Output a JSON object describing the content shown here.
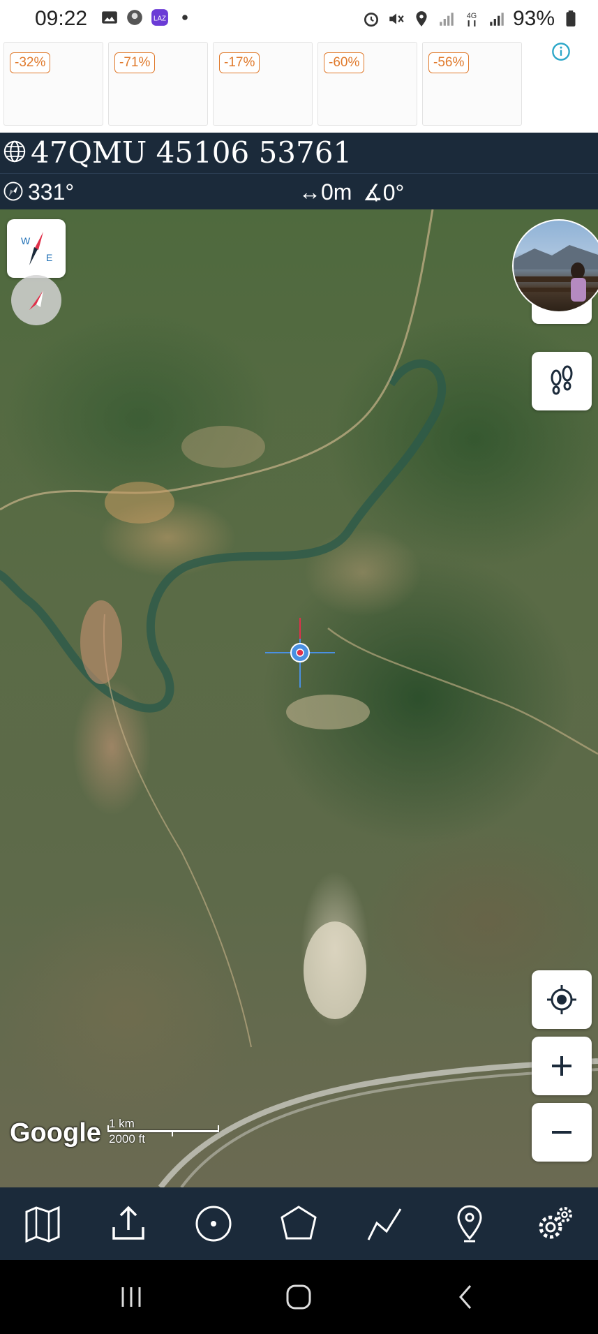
{
  "status_bar": {
    "time": "09:22",
    "battery": "93%",
    "left_icons": [
      "gallery-icon",
      "app-icon",
      "lazada-icon",
      "dot-icon"
    ],
    "right_icons": [
      "alarm-icon",
      "mute-icon",
      "location-icon",
      "signal-icon",
      "4g-icon",
      "signal-icon",
      "battery-icon"
    ]
  },
  "ads": {
    "items": [
      {
        "discount": "-32%"
      },
      {
        "discount": "-71%"
      },
      {
        "discount": "-17%"
      },
      {
        "discount": "-60%"
      },
      {
        "discount": "-56%"
      }
    ],
    "info_icon": "info-icon"
  },
  "coords": {
    "grid_ref": "47QMU 45106 53761",
    "heading": "331°",
    "distance": "↔0m",
    "angle": "∡0°"
  },
  "map": {
    "attribution": "Google",
    "scale_metric": "1 km",
    "scale_imperial": "2000 ft"
  },
  "toolbar": {
    "items": [
      "map-layers-icon",
      "share-icon",
      "point-icon",
      "polygon-icon",
      "track-icon",
      "waypoint-icon",
      "settings-icon"
    ]
  },
  "colors": {
    "header_bg": "#1b2a3a",
    "ad_badge": "#e07a2c",
    "info": "#2aa6c8",
    "crosshair": "#4a90e2",
    "accent_red": "#e0304a"
  }
}
